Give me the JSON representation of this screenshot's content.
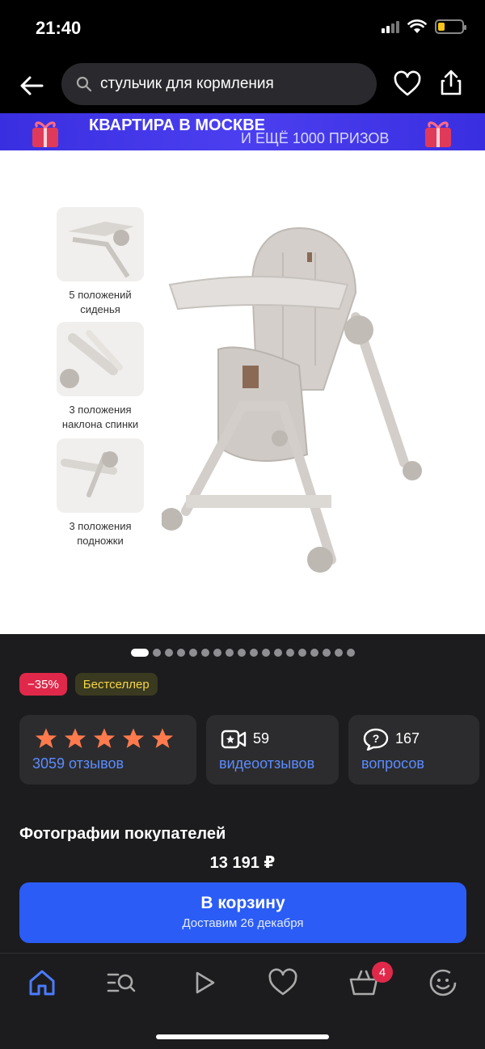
{
  "status_bar": {
    "time": "21:40"
  },
  "search": {
    "query": "стульчик для кормления"
  },
  "promo": {
    "title": "КВАРТИРА В МОСКВЕ",
    "subtitle": "И ЕЩЁ 1000 ПРИЗОВ"
  },
  "image_features": [
    {
      "caption": "5 положений сиденья"
    },
    {
      "caption": "3 положения наклона спинки"
    },
    {
      "caption": "3 положения подножки"
    }
  ],
  "gallery": {
    "total_images": 18,
    "active_index": 1
  },
  "badges": {
    "discount": "−35%",
    "bestseller": "Бестселлер"
  },
  "rating": {
    "stars": 5,
    "reviews_label": "3059 отзывов"
  },
  "video_reviews": {
    "count": "59",
    "label": "видеоотзывов"
  },
  "questions": {
    "count": "167",
    "label": "вопросов"
  },
  "section": {
    "title": "Фотографии покупателей"
  },
  "buy": {
    "price": "13 191 ₽",
    "button_label": "В корзину",
    "delivery": "Доставим 26 декабря"
  },
  "tab_bar": {
    "cart_badge": "4"
  },
  "colors": {
    "accent": "#2b5cf5",
    "discount": "#e0294a",
    "star": "#ff7a4d",
    "link": "#5b8cff"
  }
}
